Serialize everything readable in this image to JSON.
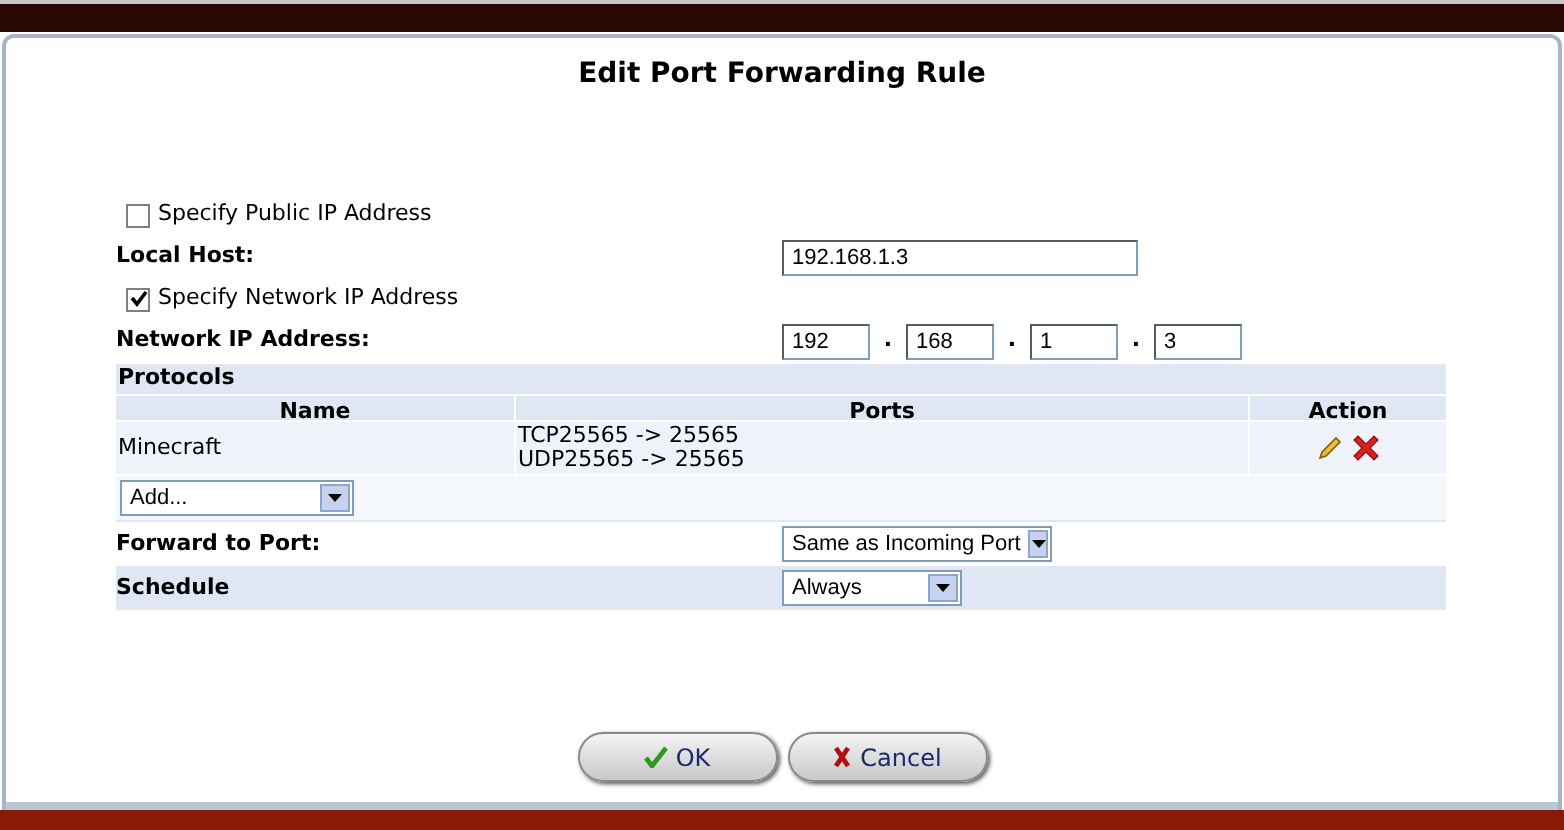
{
  "title": "Edit Port Forwarding Rule",
  "specify_public_ip": {
    "label": "Specify Public IP Address",
    "checked": false
  },
  "local_host": {
    "label": "Local Host:",
    "value": "192.168.1.3"
  },
  "specify_network_ip": {
    "label": "Specify Network IP Address",
    "checked": true
  },
  "network_ip": {
    "label": "Network IP Address:",
    "octets": [
      "192",
      "168",
      "1",
      "3"
    ],
    "separator": "."
  },
  "protocols": {
    "title": "Protocols",
    "columns": [
      "Name",
      "Ports",
      "Action"
    ],
    "rows": [
      {
        "name": "Minecraft",
        "ports": [
          "TCP25565 -> 25565",
          "UDP25565 -> 25565"
        ]
      }
    ],
    "add_select": {
      "value": "Add..."
    }
  },
  "forward_to_port": {
    "label": "Forward to Port:",
    "value": "Same as Incoming Port"
  },
  "schedule": {
    "label": "Schedule",
    "value": "Always"
  },
  "buttons": [
    {
      "kind": "ok",
      "label": "OK"
    },
    {
      "kind": "cancel",
      "label": "Cancel"
    }
  ]
}
